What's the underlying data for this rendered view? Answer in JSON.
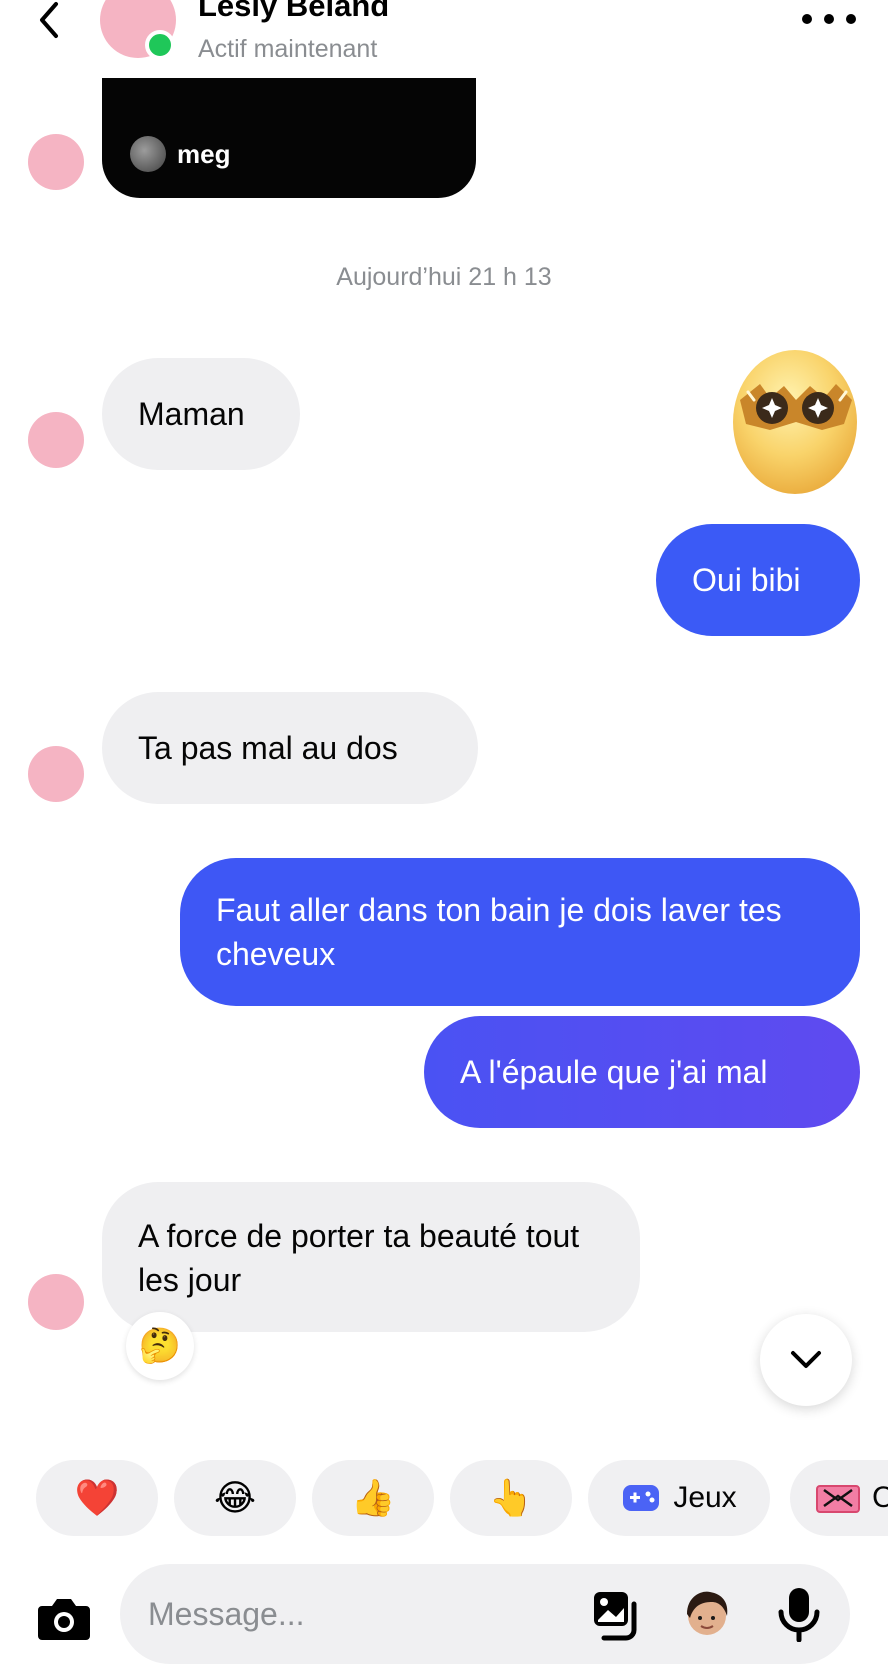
{
  "header": {
    "contact_name": "Lesly Béland",
    "status": "Actif maintenant"
  },
  "shared_post": {
    "username": "meg"
  },
  "timestamp": "Aujourd’hui 21 h 13",
  "messages": [
    {
      "direction": "incoming",
      "text": "Maman"
    },
    {
      "direction": "outgoing",
      "type": "sticker",
      "sticker": "egg-eyes-sparkle-sticker"
    },
    {
      "direction": "outgoing",
      "text": "Oui bibi"
    },
    {
      "direction": "incoming",
      "text": "Ta pas mal au dos"
    },
    {
      "direction": "outgoing",
      "text": "Faut aller dans ton bain je dois laver tes cheveux"
    },
    {
      "direction": "outgoing",
      "text": "A l'épaule que j'ai mal"
    },
    {
      "direction": "incoming",
      "text": "A force de porter ta beauté tout les jour",
      "reaction": "🤔"
    }
  ],
  "quick_replies": [
    {
      "emoji": "❤️"
    },
    {
      "emoji": "😂"
    },
    {
      "emoji": "👍"
    },
    {
      "emoji": "👆"
    },
    {
      "icon": "game-controller-icon",
      "label": "Jeux"
    },
    {
      "icon": "gift-icon",
      "label": "C"
    }
  ],
  "composer": {
    "placeholder": "Message..."
  },
  "colors": {
    "outgoing_top": "#3b5af6",
    "outgoing_bottom": "#5a4bf0",
    "incoming": "#efeff1",
    "online": "#1fc759",
    "avatar_placeholder": "#f5b4c3"
  }
}
